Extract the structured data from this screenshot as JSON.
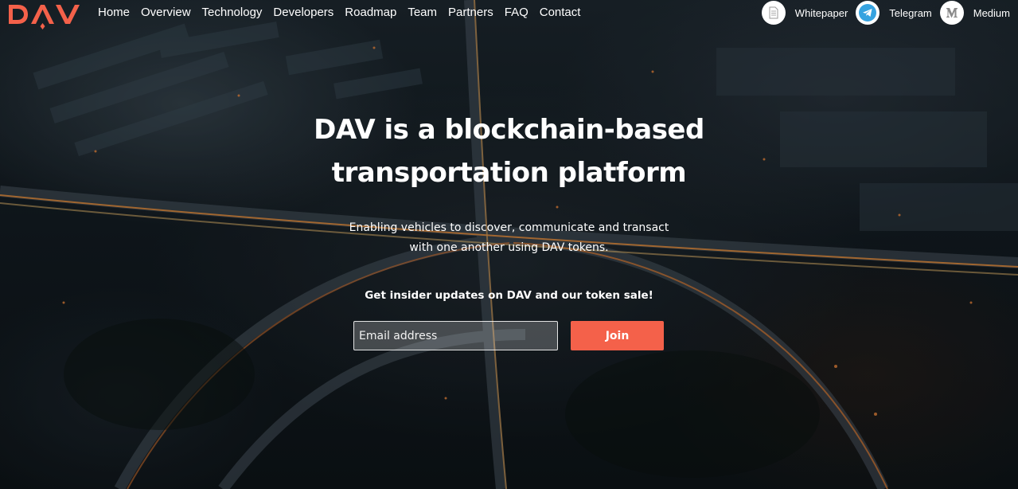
{
  "brand": {
    "logo_text": "DAV",
    "accent_color": "#f4614a"
  },
  "nav": {
    "items": [
      {
        "label": "Home"
      },
      {
        "label": "Overview"
      },
      {
        "label": "Technology"
      },
      {
        "label": "Developers"
      },
      {
        "label": "Roadmap"
      },
      {
        "label": "Team"
      },
      {
        "label": "Partners"
      },
      {
        "label": "FAQ"
      },
      {
        "label": "Contact"
      }
    ]
  },
  "social": {
    "items": [
      {
        "label": "Whitepaper",
        "icon": "document-icon"
      },
      {
        "label": "Telegram",
        "icon": "telegram-icon"
      },
      {
        "label": "Medium",
        "icon": "medium-icon"
      }
    ]
  },
  "hero": {
    "title_line1": "DAV is a blockchain-based",
    "title_line2": "transportation platform",
    "subtitle_line1": "Enabling vehicles to discover, communicate and transact",
    "subtitle_line2": "with one another using DAV tokens."
  },
  "signup": {
    "title": "Get insider updates on DAV and our token sale!",
    "email_placeholder": "Email address",
    "email_value": "",
    "join_label": "Join"
  }
}
